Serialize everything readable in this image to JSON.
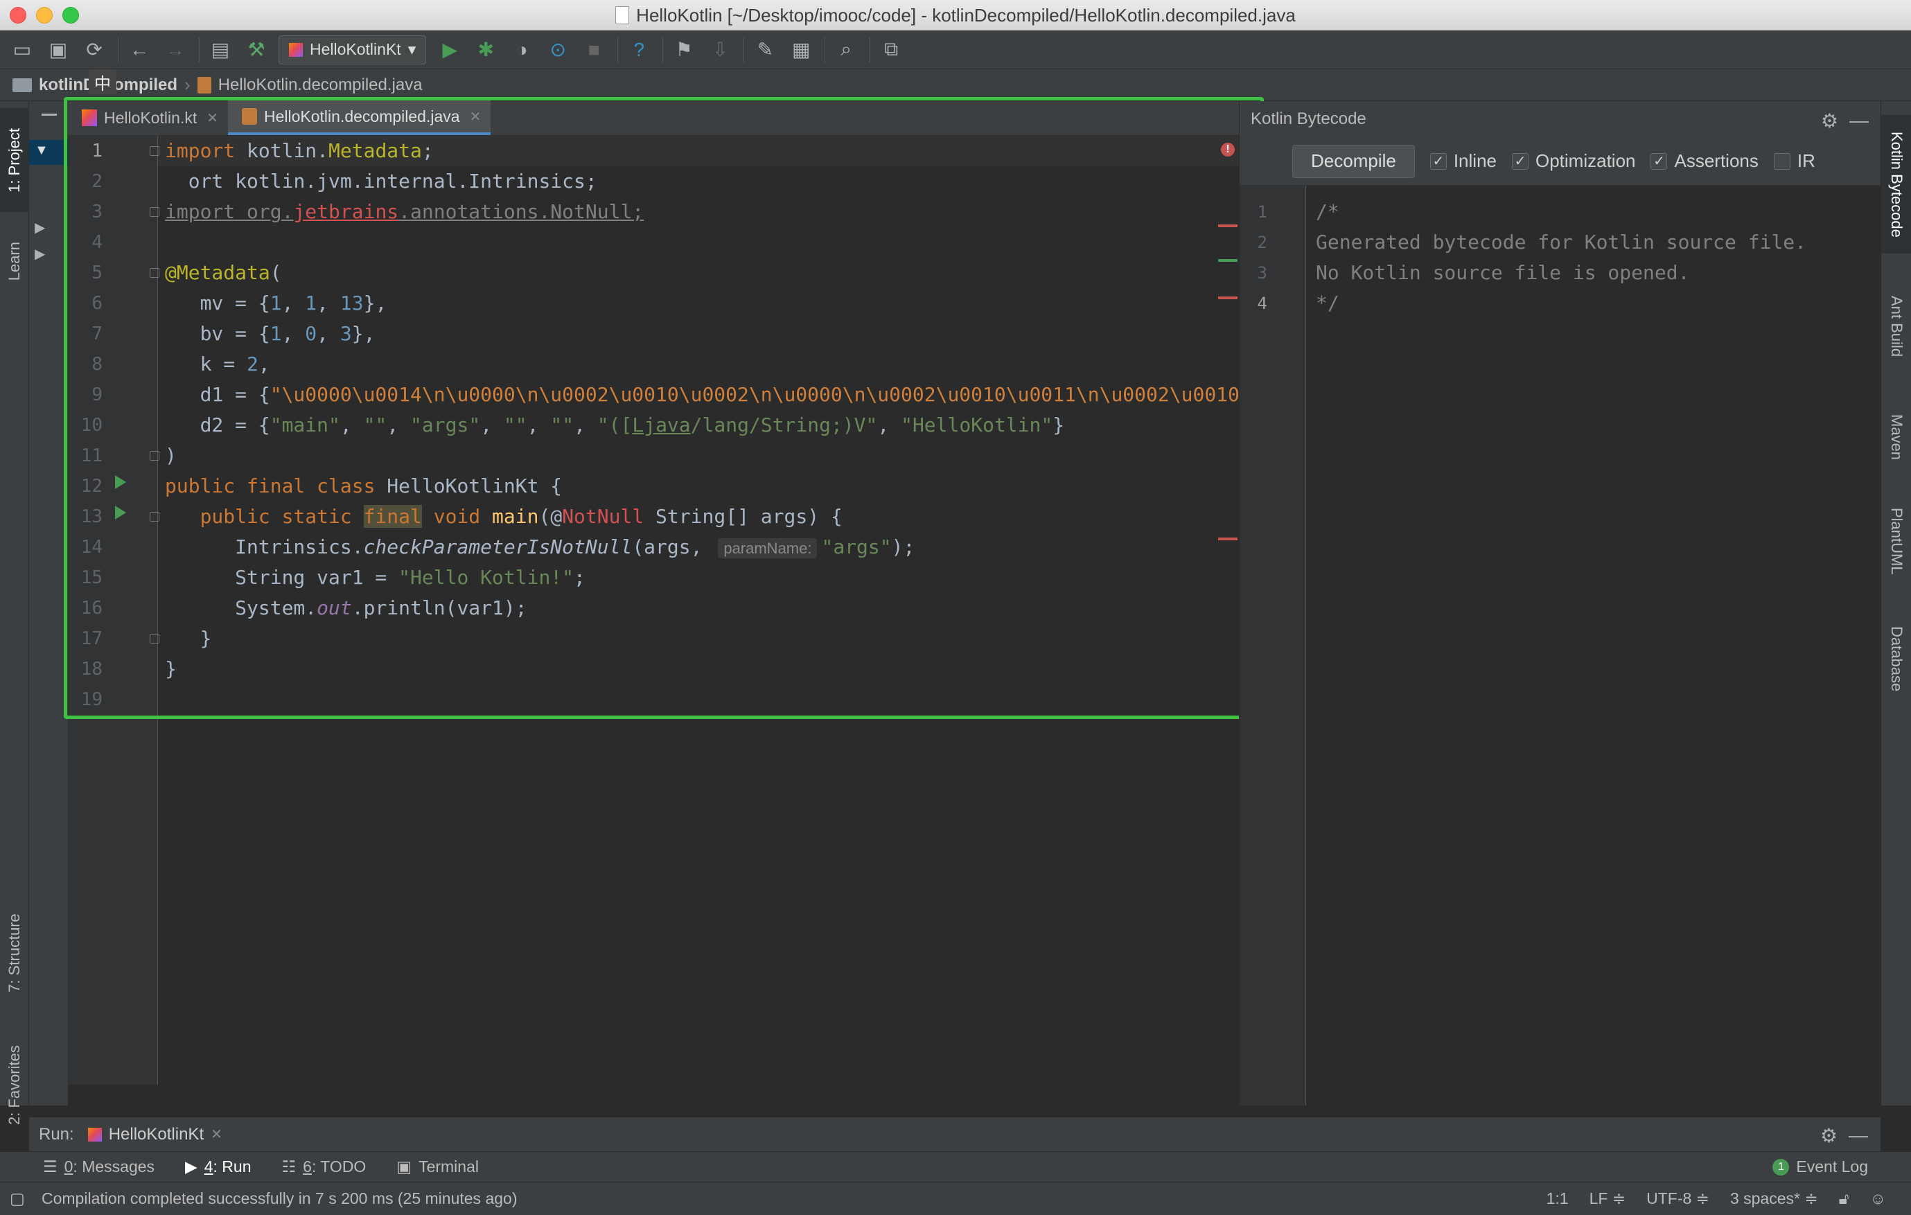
{
  "window": {
    "title": "HelloKotlin [~/Desktop/imooc/code] - kotlinDecompiled/HelloKotlin.decompiled.java"
  },
  "toolbar": {
    "run_config": "HelloKotlinKt",
    "icons": [
      "open-folder-icon",
      "save-icon",
      "sync-icon",
      "back-icon",
      "forward-icon",
      "project-structure-icon",
      "build-icon",
      "run-icon",
      "debug-icon",
      "coverage-icon",
      "profile-icon",
      "stop-icon",
      "help-icon",
      "vcs-icon",
      "vcs-update-icon",
      "settings-icon",
      "sdk-icon",
      "search-icon",
      "terminal-icon"
    ]
  },
  "breadcrumb": {
    "folder": "kotlinDecompiled",
    "file": "HelloKotlin.decompiled.java"
  },
  "left_stripe": {
    "project": "1: Project",
    "learn": "Learn",
    "structure": "7: Structure",
    "favorites": "2: Favorites"
  },
  "right_stripe": {
    "kotlin_bytecode": "Kotlin Bytecode",
    "ant_build": "Ant Build",
    "maven": "Maven",
    "plantuml": "PlantUML",
    "database": "Database"
  },
  "editor": {
    "tabs": [
      {
        "label": "HelloKotlin.kt"
      },
      {
        "label": "HelloKotlin.decompiled.java"
      }
    ],
    "ime_indicator": "中",
    "line_numbers": [
      "1",
      "2",
      "3",
      "4",
      "5",
      "6",
      "7",
      "8",
      "9",
      "10",
      "11",
      "12",
      "13",
      "14",
      "15",
      "16",
      "17",
      "18",
      "19"
    ],
    "tokens": {
      "import": "import",
      "kotlin_pkg": " kotlin.",
      "metadata_cls": "Metadata",
      "semi": ";",
      "l2_import_tail": "ort",
      "l2_rest": " kotlin.jvm.internal.Intrinsics;",
      "l3_a": "import org.",
      "l3_b": "jetbrains",
      "l3_c": ".annotations.NotNull;",
      "l5_ann": "@Metadata",
      "l5_paren": "(",
      "l6_key": "   mv = {",
      "l6_n1": "1",
      "l6_n2": "1",
      "l6_n3": "13",
      "l6_end": "},",
      "l7_key": "   bv = {",
      "l7_n1": "1",
      "l7_n2": "0",
      "l7_n3": "3",
      "l7_end": "},",
      "l8_key": "   k = ",
      "l8_n": "2",
      "l8_end": ",",
      "l9_key": "   d1 = {",
      "l9_str": "\"\\u0000\\u0014\\n\\u0000\\n\\u0002\\u0010\\u0002\\n\\u0000\\n\\u0002\\u0010\\u0011\\n\\u0002\\u0010\\u000",
      "l10_key": "   d2 = {",
      "l10_s1": "\"main\"",
      "l10_s2": "\"\"",
      "l10_s3": "\"args\"",
      "l10_s4": "\"\"",
      "l10_s5": "\"\"",
      "l10_s6a": "\"([",
      "l10_s6b": "Ljava",
      "l10_s6c": "/lang/String;)V\"",
      "l10_s7": "\"HelloKotlin\"",
      "l10_end": "}",
      "l11": ")",
      "l12_kw": "public final class",
      "l12_name": " HelloKotlinKt {",
      "l13_kw1": "   public static ",
      "l13_final": "final",
      "l13_void": " void ",
      "l13_main": "main",
      "l13_p": "(@",
      "l13_notnull": "NotNull",
      "l13_rest": " String[] args) {",
      "l14_a": "      Intrinsics.",
      "l14_m": "checkParameterIsNotNull",
      "l14_b": "(args, ",
      "l14_hint": "paramName:",
      "l14_s": "\"args\"",
      "l14_c": ");",
      "l15_a": "      String var1 = ",
      "l15_s": "\"Hello Kotlin!\"",
      "l15_c": ";",
      "l16_a": "      System.",
      "l16_out": "out",
      "l16_b": ".println(var1);",
      "l17": "   }",
      "l18": "}"
    }
  },
  "bytecode": {
    "title": "Kotlin Bytecode",
    "decompile": "Decompile",
    "options": [
      {
        "label": "Inline",
        "checked": true
      },
      {
        "label": "Optimization",
        "checked": true
      },
      {
        "label": "Assertions",
        "checked": true
      },
      {
        "label": "IR",
        "checked": false
      }
    ],
    "line_numbers": [
      "1",
      "2",
      "3",
      "4"
    ],
    "lines": [
      "/*",
      "Generated bytecode for Kotlin source file.",
      "No Kotlin source file is opened.",
      "*/"
    ]
  },
  "run_panel": {
    "label": "Run:",
    "tab": "HelloKotlinKt"
  },
  "tool_windows": {
    "messages_num": "0",
    "messages": ": Messages",
    "run_num": "4",
    "run": ": Run",
    "todo_num": "6",
    "todo": ": TODO",
    "terminal": "Terminal",
    "event_log": "Event Log",
    "event_count": "1"
  },
  "status": {
    "message": "Compilation completed successfully in 7 s 200 ms (25 minutes ago)",
    "position": "1:1",
    "line_sep": "LF ≑",
    "encoding": "UTF-8 ≑",
    "indent": "3 spaces* ≑"
  },
  "colors": {
    "highlight_frame": "#3fc142",
    "keyword": "#cc7832",
    "string": "#6a8759",
    "number": "#6897bb",
    "annotation": "#bbb529"
  }
}
